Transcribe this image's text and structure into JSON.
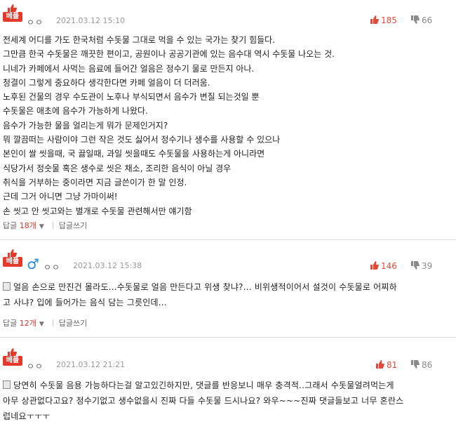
{
  "comments": [
    {
      "badge": "베플",
      "nick": "ㅇㅇ",
      "time": "2021.03.12 15:10",
      "up": "185",
      "down": "66",
      "body": "전세계 어디를 가도 한국처럼 수돗물 그대로 먹을 수 있는 국가는 찾기 힘들다.\n그만큼 한국 수돗물은 깨끗한 편이고, 공원이나 공공기관에 있는 음수대 역시 수돗물 나오는 것.\n니네가 카페에서 사먹는 음료에 들어간 얼음은 정수기 물로 만든지 아나.\n청결이 그렇게 중요하다 생각한다면 카페 얼음이 더 더러움.\n노후된 건물의 경우 수도관이 노후나 부식되면서 음수가 변질 되는것일 뿐\n수돗물은 애초에 음수가 가능하게 나왔다.\n음수가 가능한 물을 얼리는게 뭐가 문제인거지?\n뭐 깔끔떠는 사람이야 그런 작은 것도 싫어서 정수기나 생수를 사용할 수 있으나\n본인이 쌀 씻을때, 국 끓일때, 과일 씻을때도 수돗물을 사용하는게 아니라면\n식당가서 정숫물 혹은 생수로 씻은 채소, 조리한 음식이 아닐 경우\n취식을 거부하는 중이라면 지금 글쓴이가 한 말 인정.\n근데 그거 아니면 그냥 가마이써!\n손 씻고 안 씻고와는 별개로 수돗물 관련해서만 얘기함",
      "reply_label": "답글",
      "reply_count": "18개",
      "reply_write": "답글쓰기"
    },
    {
      "badge": "베플",
      "nick": "ㅇㅇ",
      "time": "2021.03.12 15:38",
      "up": "146",
      "down": "39",
      "body": "얼음 손으로 만진건 몰라도...수돗물로 얼음 만든다고 위생 찾냐?... 비위생적이어서 설것이 수돗물로 어찌하\n고 사냐? 입에 들어가는 음식 담는 그릇인데...",
      "reply_label": "답글",
      "reply_count": "12개",
      "reply_write": "답글쓰기"
    },
    {
      "badge": "베플",
      "nick": "ㅇㅇ",
      "time": "2021.03.12 21:21",
      "up": "81",
      "down": "86",
      "body": "당연히 수돗물 음용 가능하다는걸 알고있긴하지만, 댓글를 반응보니 매우 충격적..그래서 수돗물얼려먹는게\n아무 상관없다고요? 정수기없고 생수없을시 진짜 다들 수돗물 드시나요? 와우~~~진짜 댓글들보고 너무 혼란스\n럽네요ㅜㅜㅜ"
    }
  ],
  "colors": {
    "badge": "#e4392b",
    "up": "#e04a3b",
    "down": "#8a8a8a",
    "male": "#1e8de0"
  }
}
